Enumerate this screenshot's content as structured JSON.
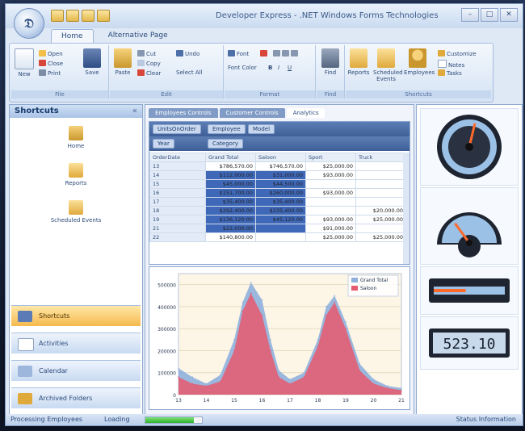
{
  "window": {
    "title": "Developer Express - .NET Windows Forms Technologies",
    "orb_glyph": "𝔇"
  },
  "ribbon": {
    "tabs": [
      "Home",
      "Alternative Page"
    ],
    "groups": {
      "file": {
        "caption": "File",
        "new": "New",
        "open": "Open",
        "close": "Close",
        "print": "Print",
        "save": "Save"
      },
      "edit": {
        "caption": "Edit",
        "paste": "Paste",
        "cut": "Cut",
        "copy": "Copy",
        "clear": "Clear",
        "undo": "Undo",
        "select_all": "Select All"
      },
      "format": {
        "caption": "Format",
        "font": "Font",
        "font_color": "Font Color",
        "bold": "B",
        "italic": "I",
        "underline": "U"
      },
      "find": {
        "caption": "Find",
        "find": "Find"
      },
      "shortcuts": {
        "caption": "Shortcuts",
        "reports": "Reports",
        "scheduled_events": "Scheduled Events",
        "employees": "Employees",
        "customize": "Customize",
        "notes": "Notes",
        "tasks": "Tasks"
      }
    }
  },
  "sidebar": {
    "title": "Shortcuts",
    "items": [
      {
        "label": "Home"
      },
      {
        "label": "Reports"
      },
      {
        "label": "Scheduled Events"
      }
    ],
    "nav": [
      {
        "label": "Shortcuts",
        "active": true
      },
      {
        "label": "Activities"
      },
      {
        "label": "Calendar"
      },
      {
        "label": "Archived Folders"
      }
    ]
  },
  "content": {
    "tabs": [
      "Employees Controls",
      "Customer Controls",
      "Analytics"
    ],
    "pivot": {
      "row1": [
        "UnitsOnOrder",
        "Employee",
        "Model"
      ],
      "row2": [
        "Year",
        "Category"
      ],
      "row_header": "OrderDate",
      "columns": [
        "Grand Total",
        "Saloon",
        "Sport",
        "Truck"
      ],
      "rows": [
        {
          "key": "13",
          "cells": [
            "$786,570.00",
            "$746,570.00",
            "$25,000.00",
            ""
          ]
        },
        {
          "key": "14",
          "cells": [
            "$112,000.00",
            "$31,000.00",
            "$93,000.00",
            ""
          ]
        },
        {
          "key": "15",
          "cells": [
            "$45,000.00",
            "$44,500.00",
            "",
            ""
          ]
        },
        {
          "key": "16",
          "cells": [
            "$151,700.00",
            "$260,000.00",
            "$93,000.00",
            ""
          ]
        },
        {
          "key": "17",
          "cells": [
            "$35,400.00",
            "$35,400.00",
            "",
            ""
          ]
        },
        {
          "key": "18",
          "cells": [
            "$292,400.00",
            "$235,400.00",
            "",
            "$20,000.00"
          ]
        },
        {
          "key": "19",
          "cells": [
            "$136,120.00",
            "$45,120.00",
            "$93,000.00",
            "$25,000.00"
          ]
        },
        {
          "key": "21",
          "cells": [
            "$22,000.00",
            "",
            "$91,000.00",
            ""
          ]
        },
        {
          "key": "22",
          "cells": [
            "$140,800.00",
            "",
            "$25,000.00",
            "$25,000.00"
          ]
        }
      ]
    }
  },
  "chart_data": {
    "type": "area",
    "x": [
      13,
      13.5,
      14,
      14.5,
      15,
      15.3,
      15.6,
      16,
      16.3,
      16.6,
      17,
      17.5,
      18,
      18.3,
      18.6,
      19,
      19.5,
      20,
      20.5,
      21
    ],
    "series": [
      {
        "name": "Grand Total",
        "values": [
          120000,
          80000,
          50000,
          90000,
          250000,
          420000,
          510000,
          430000,
          250000,
          110000,
          70000,
          100000,
          250000,
          400000,
          450000,
          330000,
          140000,
          70000,
          40000,
          30000
        ],
        "color": "#8fb0dd"
      },
      {
        "name": "Saloon",
        "values": [
          80000,
          50000,
          40000,
          60000,
          200000,
          380000,
          460000,
          360000,
          200000,
          80000,
          50000,
          80000,
          220000,
          360000,
          420000,
          300000,
          110000,
          50000,
          30000,
          20000
        ],
        "color": "#e65a6e"
      }
    ],
    "ylim": [
      0,
      550000
    ],
    "yticks": [
      "500000",
      "400000",
      "300000",
      "200000",
      "100000",
      "0"
    ],
    "xticks": [
      "13",
      "14",
      "15",
      "16",
      "17",
      "18",
      "19",
      "20",
      "21"
    ],
    "legend": "top-right",
    "grid": true
  },
  "gauges": {
    "digital_value": "523.10",
    "speed_needle": 0.55,
    "half_needle": 0.3,
    "linear_level": 0.45
  },
  "status": {
    "text": "Processing Employees",
    "loading": "Loading",
    "progress": 0.85,
    "right_text": "Status Information"
  }
}
